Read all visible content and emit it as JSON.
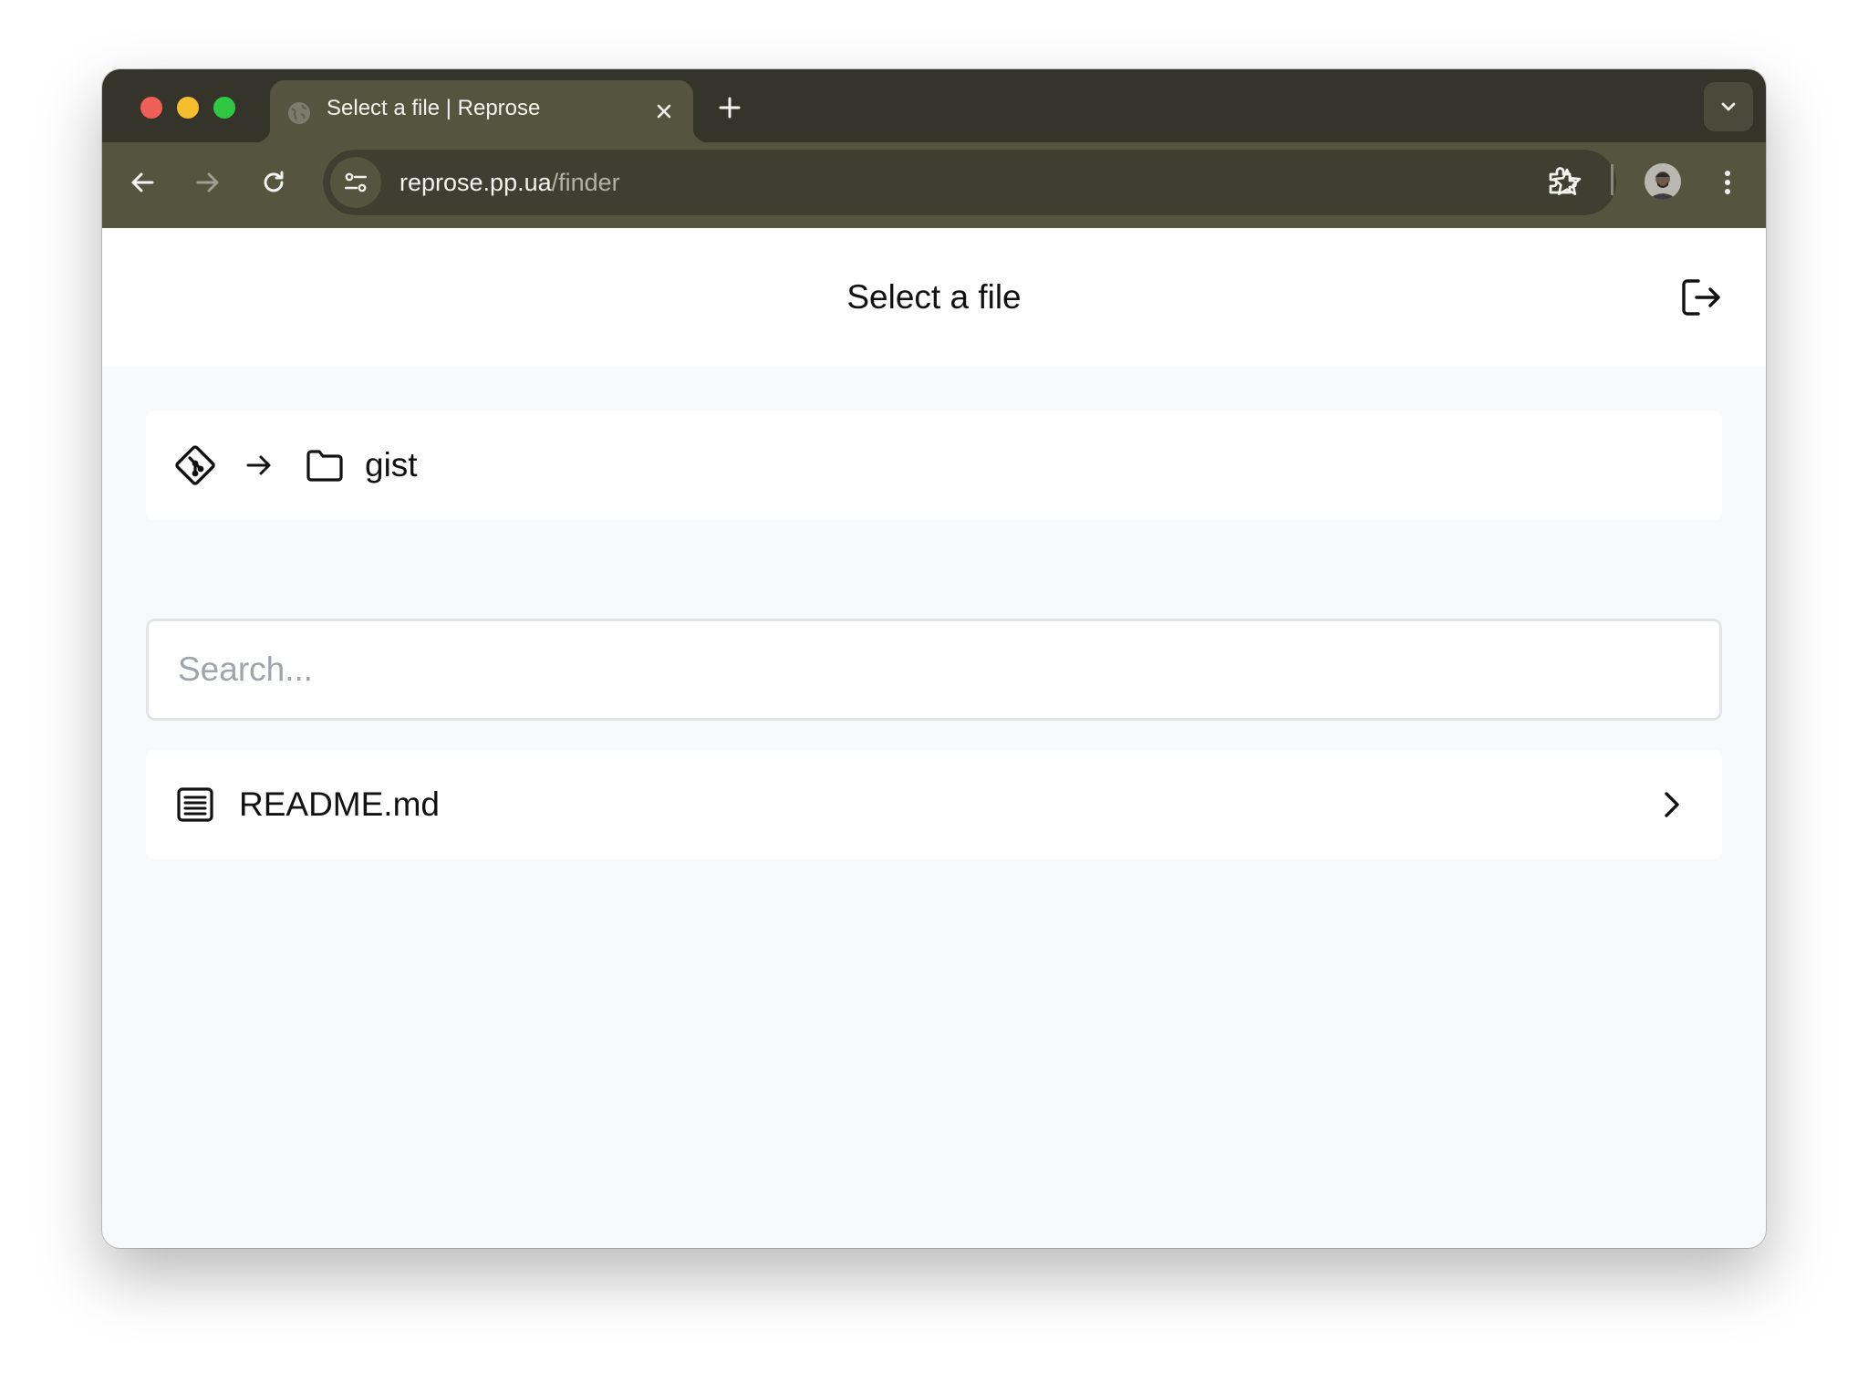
{
  "browser": {
    "tab_title": "Select a file | Reprose",
    "url_host": "reprose.pp.ua",
    "url_path": "/finder"
  },
  "icons": {
    "tab_favicon": "globe-icon",
    "tab_close": "close-icon",
    "new_tab": "plus-icon",
    "tab_search": "chevron-down-icon",
    "back": "arrow-left-icon",
    "forward": "arrow-right-icon",
    "reload": "reload-icon",
    "site_info": "tune-icon",
    "bookmark": "star-icon",
    "extensions": "puzzle-icon",
    "menu": "more-vertical-icon",
    "logout": "logout-icon",
    "repo": "git-icon",
    "breadcrumb_separator": "arrow-right-icon",
    "folder": "folder-icon",
    "file": "document-icon",
    "open": "chevron-right-icon"
  },
  "header": {
    "title": "Select a file"
  },
  "breadcrumb": {
    "folder": "gist"
  },
  "search": {
    "placeholder": "Search...",
    "value": ""
  },
  "files": [
    {
      "name": "README.md"
    }
  ],
  "colors": {
    "tab_strip": "#35342a",
    "toolbar": "#55543f",
    "page_background": "#f8f9fb",
    "card": "#ffffff"
  }
}
